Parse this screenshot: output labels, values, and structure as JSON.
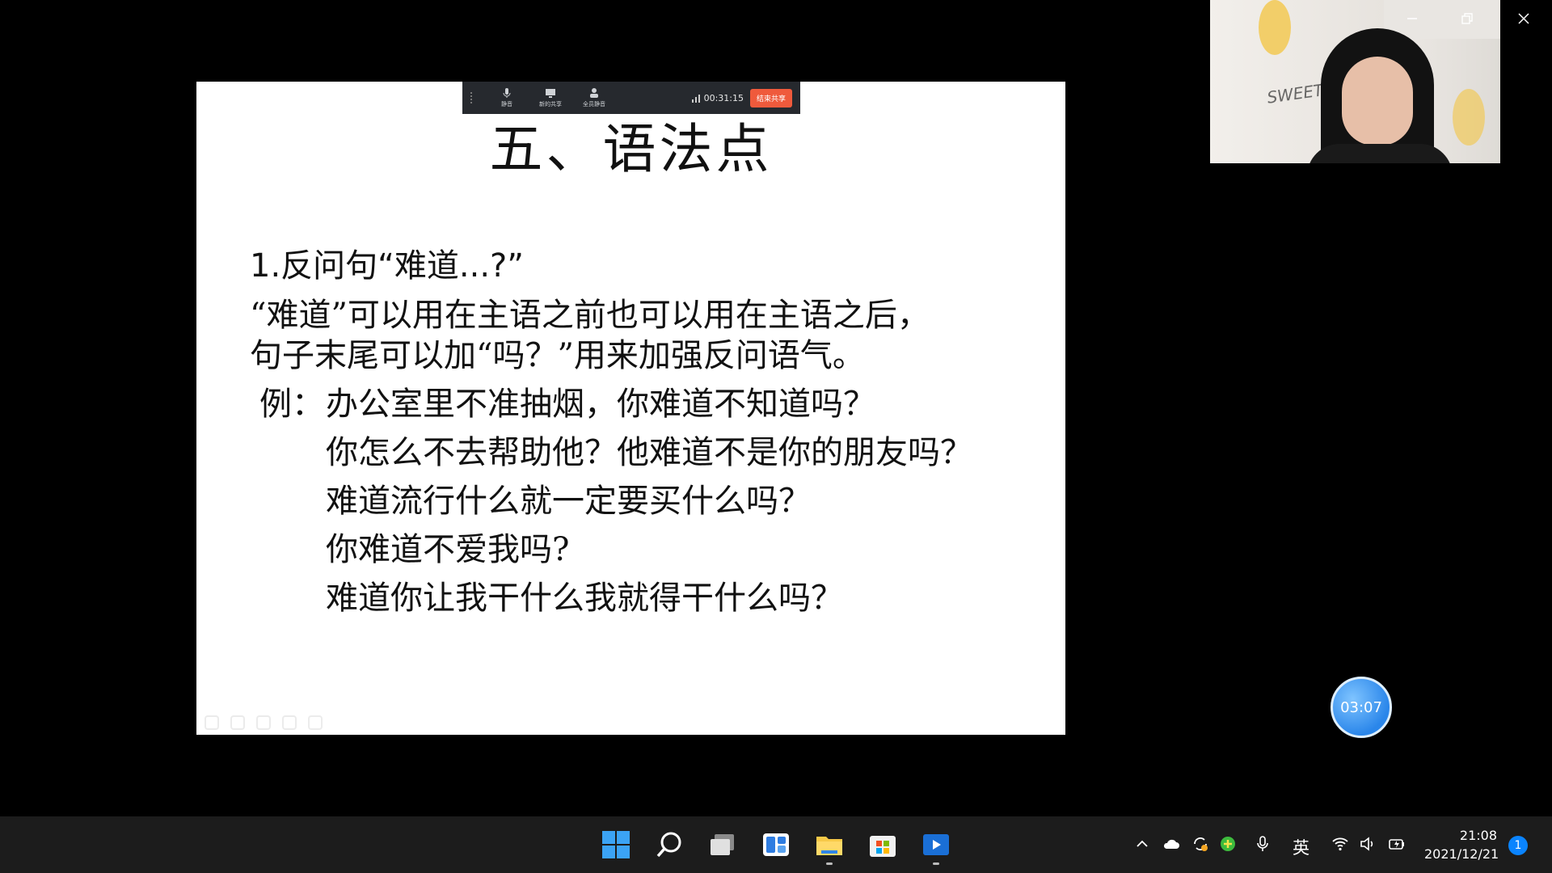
{
  "slide": {
    "title": "五、语法点",
    "point_heading": "1.反问句“难道...?”",
    "description_lines": [
      "“难道”可以用在主语之前也可以用在主语之后，",
      "句子末尾可以加“吗？”用来加强反问语气。"
    ],
    "example_label": "例：",
    "examples": [
      "办公室里不准抽烟，你难道不知道吗？",
      "你怎么不去帮助他？他难道不是你的朋友吗？",
      "难道流行什么就一定要买什么吗？",
      "你难道不爱我吗?",
      "难道你让我干什么我就得干什么吗？"
    ]
  },
  "meeting_toolbar": {
    "timer": "00:31:15"
  },
  "webcam": {
    "backdrop_text": "SWEET Hello"
  },
  "floating_timer": "03:07",
  "tray": {
    "ime_label": "英",
    "time": "21:08",
    "date": "2021/12/21",
    "notification_count": "1"
  },
  "icons": {
    "start": "windows-start-icon",
    "search": "search-icon",
    "taskview": "task-view-icon",
    "widgets": "widgets-icon",
    "explorer": "file-explorer-icon",
    "store": "microsoft-store-icon",
    "media": "media-player-icon"
  },
  "colors": {
    "end_share": "#ef5a3c",
    "timer_blue": "#2a86ea",
    "taskbar": "#1c1c1c"
  }
}
